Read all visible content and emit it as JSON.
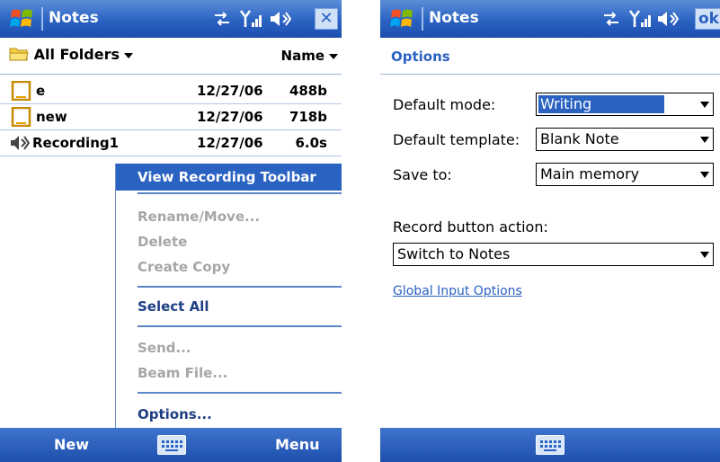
{
  "colors": {
    "titlebar": "#2a62c2",
    "highlight": "#2a62c2",
    "menu_text": "#1e3f84",
    "disabled": "#a6a6a6",
    "link": "#2a62c2"
  },
  "left_screen": {
    "title": "Notes",
    "close_label": "✕",
    "folder_selector": "All Folders",
    "sort_selector": "Name",
    "files": [
      {
        "icon": "note-icon",
        "name": "e",
        "date": "12/27/06",
        "size": "488b"
      },
      {
        "icon": "note-icon",
        "name": "new",
        "date": "12/27/06",
        "size": "718b"
      },
      {
        "icon": "speaker-icon",
        "name": "Recording1",
        "date": "12/27/06",
        "size": "6.0s"
      }
    ],
    "menu": {
      "view_recording_toolbar": "View Recording Toolbar",
      "rename_move": "Rename/Move...",
      "delete": "Delete",
      "create_copy": "Create Copy",
      "select_all": "Select All",
      "send": "Send...",
      "beam_file": "Beam File...",
      "options": "Options..."
    },
    "softkeys": {
      "left": "New",
      "right": "Menu"
    }
  },
  "right_screen": {
    "title": "Notes",
    "ok_label": "ok",
    "heading": "Options",
    "default_mode_label": "Default mode:",
    "default_mode_value": "Writing",
    "default_template_label": "Default template:",
    "default_template_value": "Blank Note",
    "save_to_label": "Save to:",
    "save_to_value": "Main memory",
    "record_button_label": "Record button action:",
    "record_button_value": "Switch to Notes",
    "global_input_link": "Global Input Options"
  }
}
